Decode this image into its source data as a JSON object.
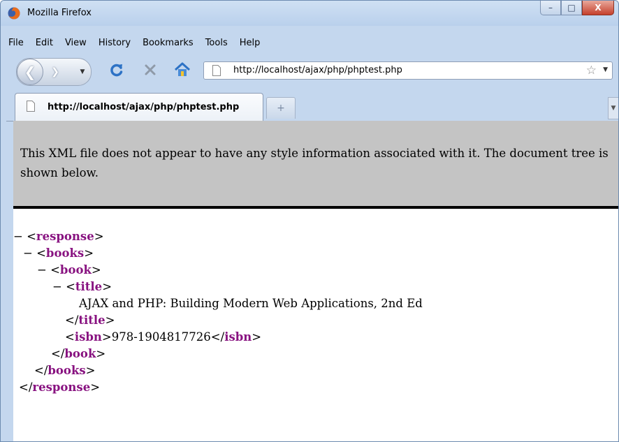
{
  "window": {
    "title": "Mozilla Firefox",
    "caption_buttons": {
      "minimize": "–",
      "maximize": "□",
      "close": "X"
    }
  },
  "menu": [
    {
      "label": "File"
    },
    {
      "label": "Edit"
    },
    {
      "label": "View"
    },
    {
      "label": "History"
    },
    {
      "label": "Bookmarks"
    },
    {
      "label": "Tools"
    },
    {
      "label": "Help"
    }
  ],
  "navigation": {
    "url": "http://localhost/ajax/php/phptest.php",
    "back_icon": "back-arrow-icon",
    "forward_icon": "forward-arrow-icon",
    "reload_icon": "reload-icon",
    "stop_icon": "stop-icon",
    "home_icon": "home-icon",
    "bookmark_icon": "star-icon"
  },
  "tabs": [
    {
      "label": "http://localhost/ajax/php/phptest.php",
      "active": true
    }
  ],
  "newtab_label": "+",
  "xml_viewer": {
    "message": "This XML file does not appear to have any style information associated with it. The document tree is shown below.",
    "collapse_marker": "−",
    "tags": {
      "response": "response",
      "books": "books",
      "book": "book",
      "title": "title",
      "isbn": "isbn"
    },
    "title_text": "AJAX and PHP: Building Modern Web Applications, 2nd Ed",
    "isbn_text": "978-1904817726"
  },
  "colors": {
    "tag_name": "#881280",
    "chrome": "#c4d7ee",
    "xml_header_bg": "#c4c4c4"
  }
}
